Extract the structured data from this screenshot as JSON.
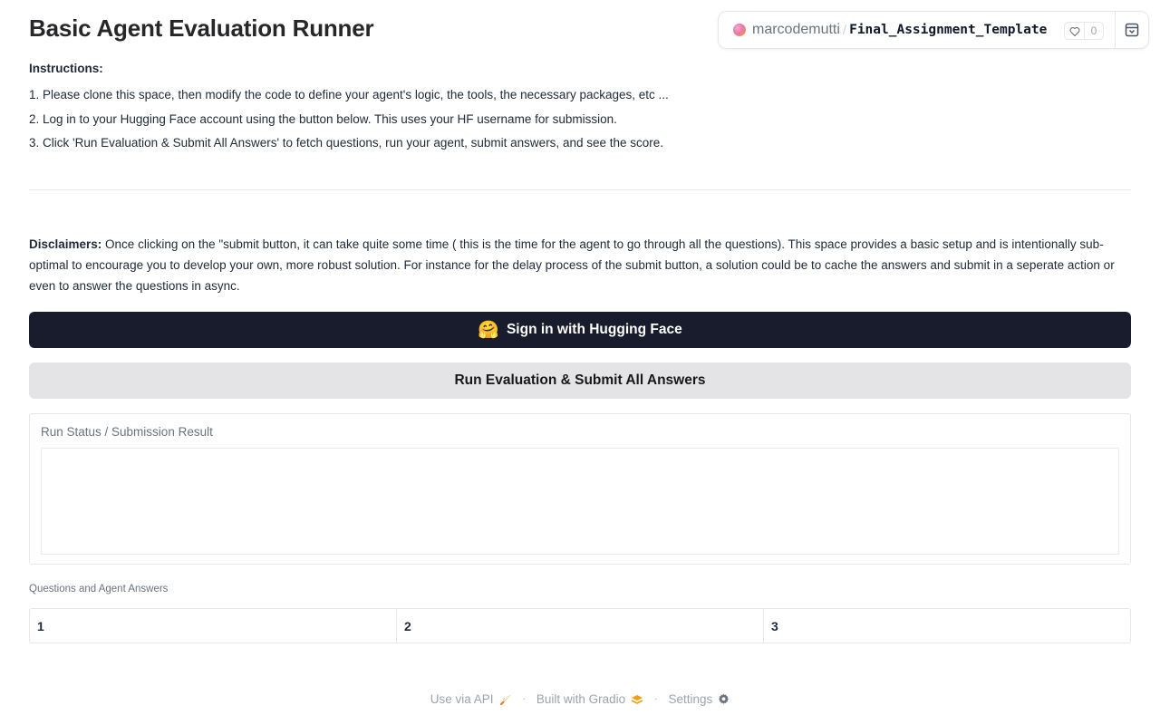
{
  "page": {
    "title": "Basic Agent Evaluation Runner"
  },
  "space_badge": {
    "owner": "marcodemutti",
    "separator": "/",
    "repo": "Final_Assignment_Template",
    "likes": "0"
  },
  "instructions": {
    "heading": "Instructions:",
    "lines": [
      "1. Please clone this space, then modify the code to define your agent's logic, the tools, the necessary packages, etc ...",
      "2. Log in to your Hugging Face account using the button below. This uses your HF username for submission.",
      "3. Click 'Run Evaluation & Submit All Answers' to fetch questions, run your agent, submit answers, and see the score."
    ]
  },
  "disclaimer": {
    "label": "Disclaimers:",
    "text": " Once clicking on the \"submit button, it can take quite some time ( this is the time for the agent to go through all the questions). This space provides a basic setup and is intentionally sub-optimal to encourage you to develop your own, more robust solution. For instance for the delay process of the submit button, a solution could be to cache the answers and submit in a seperate action or even to answer the questions in async."
  },
  "buttons": {
    "signin_icon": "🤗",
    "signin_label": "Sign in with Hugging Face",
    "run_label": "Run Evaluation & Submit All Answers"
  },
  "status": {
    "label": "Run Status / Submission Result",
    "value": ""
  },
  "qa_table": {
    "label": "Questions and Agent Answers",
    "headers": [
      "1",
      "2",
      "3"
    ]
  },
  "footer": {
    "api": "Use via API",
    "built": "Built with Gradio",
    "settings": "Settings",
    "separator": "·"
  }
}
